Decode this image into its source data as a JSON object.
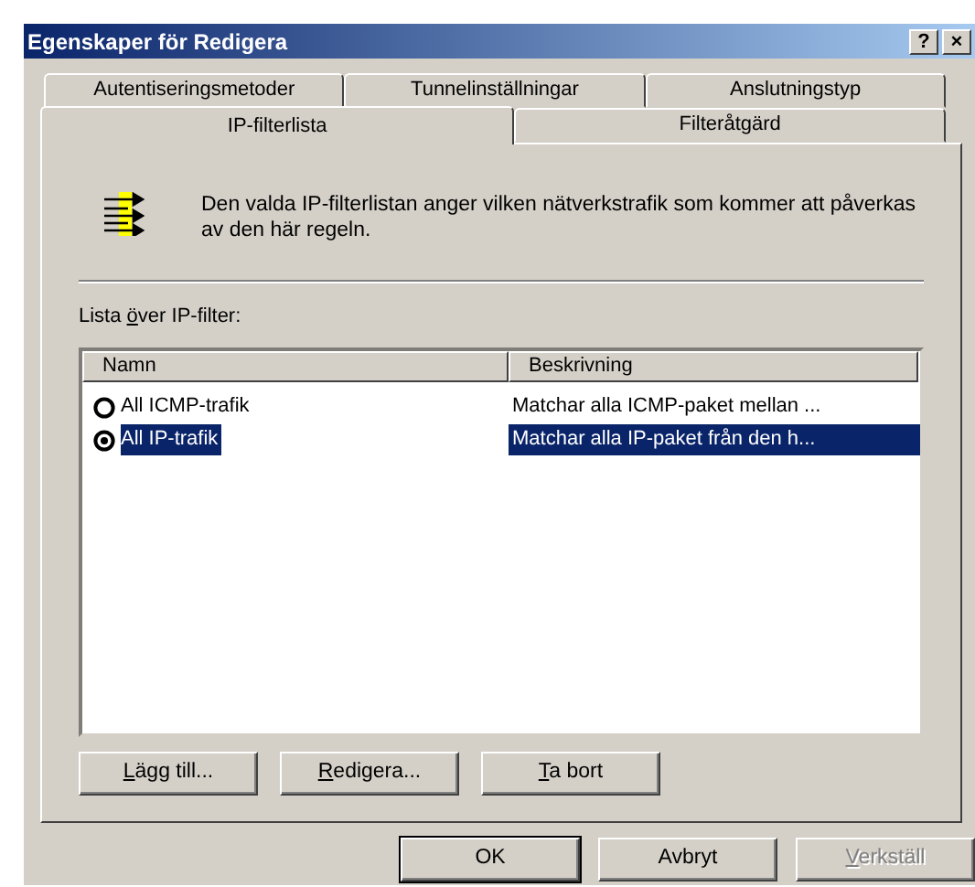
{
  "window": {
    "title": "Egenskaper för Redigera",
    "title_buttons": [
      "?",
      "×"
    ]
  },
  "tab_rows": [
    [
      {
        "label": "Autentiseringsmetoder",
        "selected": false
      },
      {
        "label": "Tunnelinställningar",
        "selected": false
      },
      {
        "label": "Anslutningstyp",
        "selected": false
      }
    ],
    [
      {
        "label": "IP-filterlista",
        "selected": true
      },
      {
        "label": "Filteråtgärd",
        "selected": false
      }
    ]
  ],
  "description": "Den valda IP-filterlistan anger vilken nätverkstrafik som kommer att påverkas av den här regeln.",
  "list_label": {
    "before": "Lista ",
    "mnemonic": "ö",
    "after": "ver IP-filter:"
  },
  "table": {
    "columns": [
      "Namn",
      "Beskrivning"
    ],
    "rows": [
      {
        "name": "All ICMP-trafik",
        "description": "Matchar alla ICMP-paket mellan ...",
        "checked": false,
        "selected": false
      },
      {
        "name": "All IP-trafik",
        "description": "Matchar alla IP-paket från den h...",
        "checked": true,
        "selected": true
      }
    ]
  },
  "list_buttons": [
    {
      "mnemonic": "L",
      "after": "ägg till..."
    },
    {
      "mnemonic": "R",
      "after": "edigera..."
    },
    {
      "mnemonic": "T",
      "after": "a bort"
    }
  ],
  "dialog_buttons": [
    {
      "after": "OK",
      "default": true,
      "disabled": false
    },
    {
      "after": "Avbryt",
      "default": false,
      "disabled": false
    },
    {
      "mnemonic": "V",
      "after": "erkställ",
      "default": false,
      "disabled": true
    }
  ]
}
